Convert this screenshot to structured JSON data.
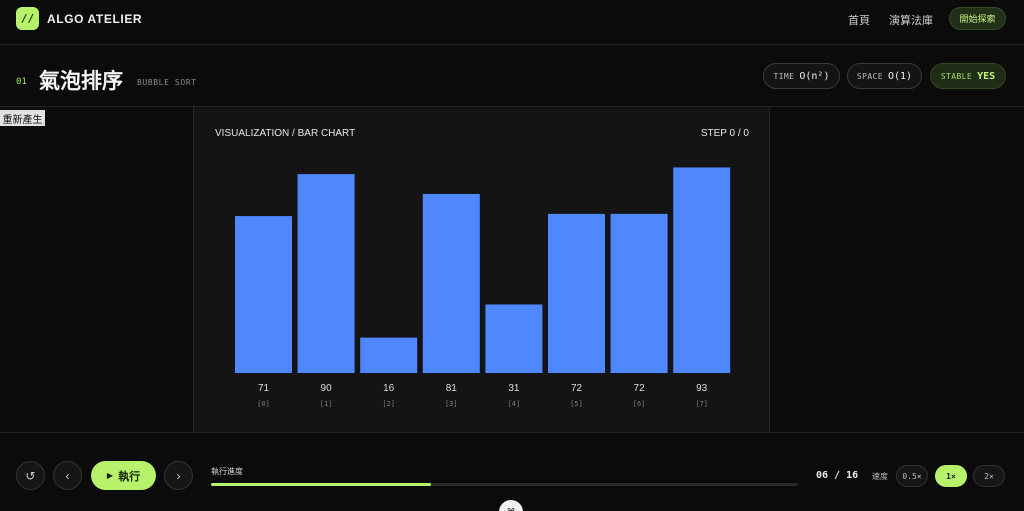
{
  "nav": {
    "logo_glyph": "//",
    "brand": "ALGO ATELIER",
    "links": [
      "首頁",
      "演算法庫"
    ],
    "cta": "開始探索"
  },
  "header": {
    "number": "01",
    "title": "氣泡排序",
    "subtitle": "BUBBLE SORT",
    "badges": [
      {
        "key": "TIME",
        "value": "O(n²)"
      },
      {
        "key": "SPACE",
        "value": "O(1)"
      },
      {
        "key": "STABLE",
        "value": "YES"
      }
    ]
  },
  "regenerate_label": "重新產生",
  "stage": {
    "title": "VISUALIZATION / BAR CHART",
    "step": "STEP 0 / 0"
  },
  "chart_data": {
    "type": "bar",
    "categories": [
      "[0]",
      "[1]",
      "[2]",
      "[3]",
      "[4]",
      "[5]",
      "[6]",
      "[7]"
    ],
    "values": [
      71,
      90,
      16,
      81,
      31,
      72,
      72,
      93
    ],
    "ylim": [
      0,
      100
    ],
    "bar_color": "#4f87ff",
    "grid": false,
    "legend": "none"
  },
  "controls": {
    "reset_icon": "↺",
    "prev_icon": "‹",
    "run_icon": "▶",
    "run_label": "執行",
    "next_icon": "›",
    "progress_label": "執行進度",
    "progress_fraction": 0.375,
    "counter": "06 / 16",
    "speed_label": "速度",
    "speeds": [
      "0.5×",
      "1×",
      "2×"
    ],
    "active_speed": "1×",
    "bottom_glyph": "⌘"
  },
  "colors": {
    "accent": "#b6f36a",
    "bar": "#4f87ff",
    "background": "#0b0b0b"
  }
}
